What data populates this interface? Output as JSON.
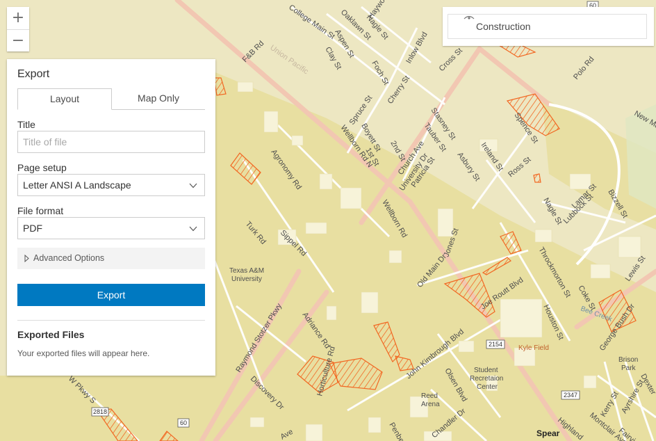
{
  "zoom": {
    "in_label": "+",
    "out_label": "−"
  },
  "legend": {
    "layer_label": "Construction"
  },
  "export_panel": {
    "title": "Export",
    "tabs": [
      {
        "label": "Layout",
        "active": true
      },
      {
        "label": "Map Only",
        "active": false
      }
    ],
    "title_field": {
      "label": "Title",
      "placeholder": "Title of file",
      "value": ""
    },
    "page_setup": {
      "label": "Page setup",
      "selected": "Letter ANSI A Landscape"
    },
    "file_format": {
      "label": "File format",
      "selected": "PDF"
    },
    "advanced_label": "Advanced Options",
    "export_button": "Export",
    "exported_files_heading": "Exported Files",
    "exported_files_empty": "Your exported files will appear here."
  },
  "map": {
    "colors": {
      "base": "#ede7c2",
      "campus": "#e6dc96",
      "building": "#f7f3d9",
      "road": "#ffffff",
      "major_road": "#f2c7b2",
      "construction": "#f26722"
    },
    "labels": [
      {
        "text": "College Main St"
      },
      {
        "text": "Aspen St"
      },
      {
        "text": "Oaklawn St"
      },
      {
        "text": "Nagle St"
      },
      {
        "text": "Boyett St"
      },
      {
        "text": "Wellborn Rd"
      },
      {
        "text": "University Dr"
      },
      {
        "text": "Agronomy Rd"
      },
      {
        "text": "Sippel Rd"
      },
      {
        "text": "Turk Rd"
      },
      {
        "text": "Texas A&M"
      },
      {
        "text": "University"
      },
      {
        "text": "Raymond Stotzer Pkwy"
      },
      {
        "text": "Adriance Rd"
      },
      {
        "text": "Horticulture Rd"
      },
      {
        "text": "Discovery Dr"
      },
      {
        "text": "John Kimbrough Blvd"
      },
      {
        "text": "Olsen Blvd"
      },
      {
        "text": "Student"
      },
      {
        "text": "Recretaion"
      },
      {
        "text": "Center"
      },
      {
        "text": "Reed"
      },
      {
        "text": "Arena"
      },
      {
        "text": "Kyle Field"
      },
      {
        "text": "Houston St"
      },
      {
        "text": "Throckmorton St"
      },
      {
        "text": "Coke St"
      },
      {
        "text": "Lewis St"
      },
      {
        "text": "George Bush Dr"
      },
      {
        "text": "Brison"
      },
      {
        "text": "Park"
      },
      {
        "text": "Spence St"
      },
      {
        "text": "Ross St"
      },
      {
        "text": "Ireland St"
      },
      {
        "text": "Asbury St"
      },
      {
        "text": "Lamar St"
      },
      {
        "text": "Bizzell St"
      },
      {
        "text": "Lubbock St"
      },
      {
        "text": "Nagle St"
      },
      {
        "text": "Polo Rd"
      },
      {
        "text": "Cross St"
      },
      {
        "text": "Church Ave"
      },
      {
        "text": "Patricia St"
      },
      {
        "text": "Tauber St"
      },
      {
        "text": "Stasney St"
      },
      {
        "text": "Cherry St"
      },
      {
        "text": "Spruce St"
      },
      {
        "text": "1st St"
      },
      {
        "text": "2nd St"
      },
      {
        "text": "Foch St"
      },
      {
        "text": "Clay St"
      },
      {
        "text": "F&B Rd"
      },
      {
        "text": "Union Pacific"
      },
      {
        "text": "Old Main Dr"
      },
      {
        "text": "Jones St"
      },
      {
        "text": "Joe Routt Blvd"
      },
      {
        "text": "Bee Creek"
      },
      {
        "text": "Penberthy"
      },
      {
        "text": "Chandler Dr"
      },
      {
        "text": "Highland"
      },
      {
        "text": "Montclair Ave"
      },
      {
        "text": "Fairview"
      },
      {
        "text": "Ayrshire St"
      },
      {
        "text": "Kerry St"
      },
      {
        "text": "Dexter"
      },
      {
        "text": "Spear"
      },
      {
        "text": "New Main"
      },
      {
        "text": "Wellborn Rd N"
      },
      {
        "text": "Inlow Blvd"
      },
      {
        "text": "Haywood Dr"
      },
      {
        "text": "W Pkwy S"
      },
      {
        "text": "Ave"
      }
    ],
    "shields": [
      {
        "text": "60"
      },
      {
        "text": "2154"
      },
      {
        "text": "2347"
      },
      {
        "text": "2818"
      },
      {
        "text": "60"
      }
    ]
  }
}
